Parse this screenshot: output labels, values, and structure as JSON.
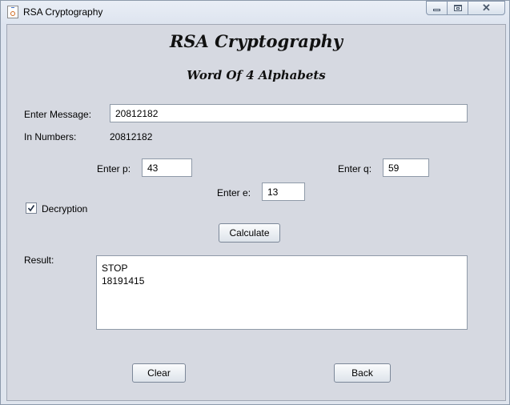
{
  "window": {
    "title": "RSA Cryptography"
  },
  "header": {
    "title": "RSA Cryptography",
    "subtitle": "Word Of 4 Alphabets"
  },
  "form": {
    "message_label": "Enter Message:",
    "message_value": "20812182",
    "numbers_label": "In Numbers:",
    "numbers_value": "20812182",
    "p_label": "Enter p:",
    "p_value": "43",
    "q_label": "Enter q:",
    "q_value": "59",
    "e_label": "Enter e:",
    "e_value": "13",
    "decryption_label": "Decryption",
    "decryption_checked": true,
    "calculate_label": "Calculate",
    "result_label": "Result:",
    "result_lines": [
      "STOP",
      "18191415"
    ]
  },
  "footer": {
    "clear_label": "Clear",
    "back_label": "Back"
  },
  "icons": {
    "app": "java-cup-icon",
    "minimize": "minimize-icon",
    "maximize": "maximize-icon",
    "close": "close-icon",
    "check": "checkmark-icon"
  }
}
